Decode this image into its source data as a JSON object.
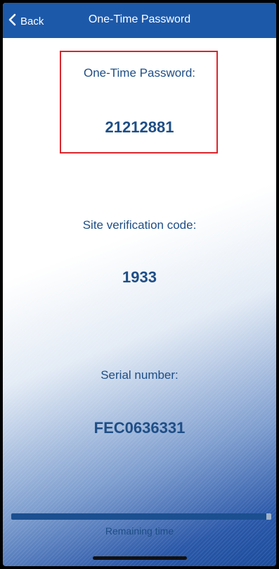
{
  "navbar": {
    "back_label": "Back",
    "title": "One-Time Password"
  },
  "otp": {
    "label": "One-Time Password:",
    "value": "21212881"
  },
  "site_verification": {
    "label": "Site verification code:",
    "value": "1933"
  },
  "serial": {
    "label": "Serial number:",
    "value": "FEC0636331"
  },
  "timer": {
    "label": "Remaining time",
    "remaining_fraction": 0.98
  },
  "colors": {
    "nav_background": "#1d59a9",
    "text": "#1e4e86",
    "highlight_border": "#d9262c",
    "progress_fill": "#1b4f90"
  },
  "icons": {
    "back": "chevron-left-icon"
  }
}
